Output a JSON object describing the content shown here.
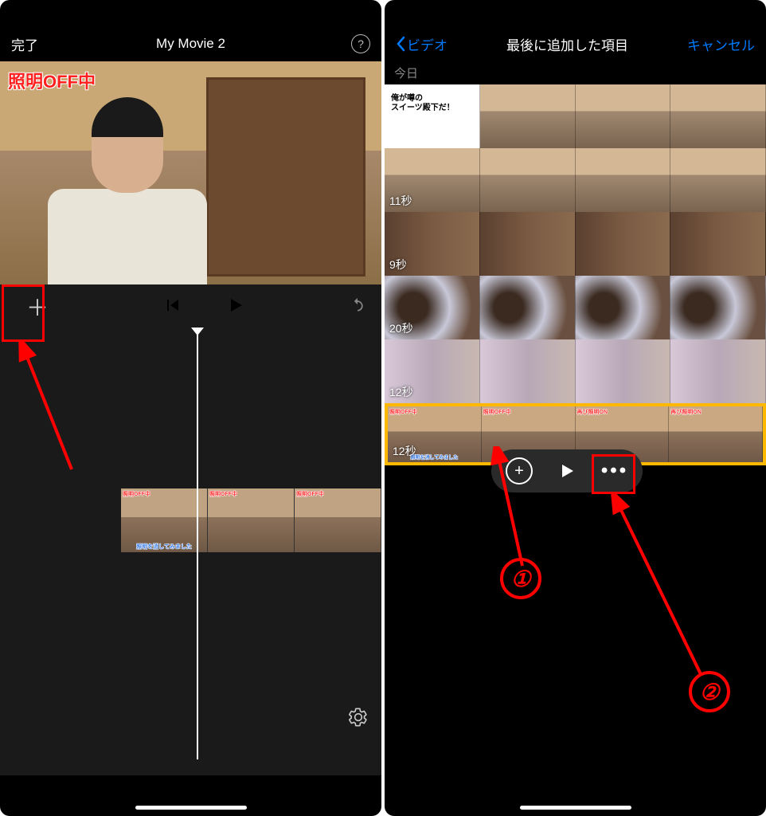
{
  "left_phone": {
    "nav": {
      "done": "完了",
      "title": "My Movie 2",
      "help": "?"
    },
    "preview_overlay": "照明OFF中",
    "clip_frames": [
      {
        "top": "照明OFF中",
        "bottom": "照明を消してみました"
      },
      {
        "top": "照明OFF中",
        "bottom": ""
      },
      {
        "top": "照明OFF中",
        "bottom": ""
      }
    ]
  },
  "right_phone": {
    "nav": {
      "back": "ビデオ",
      "title": "最後に追加した項目",
      "cancel": "キャンセル"
    },
    "section": "今日",
    "rows": [
      {
        "duration": "",
        "thumb_text": "俺が噂の\nスイーツ殿下だ！"
      },
      {
        "duration": "11秒"
      },
      {
        "duration": "9秒"
      },
      {
        "duration": "20秒"
      },
      {
        "duration": "12秒"
      }
    ],
    "selected_row": {
      "duration": "12秒",
      "frames": [
        {
          "top": "照明OFF中",
          "bottom": "照明を消してみました"
        },
        {
          "top": "照明OFF中",
          "bottom": ""
        },
        {
          "top": "再び照明ON",
          "bottom": ""
        },
        {
          "top": "再び照明ON",
          "bottom": ""
        }
      ]
    }
  },
  "annotations": {
    "num1": "①",
    "num2": "②"
  }
}
